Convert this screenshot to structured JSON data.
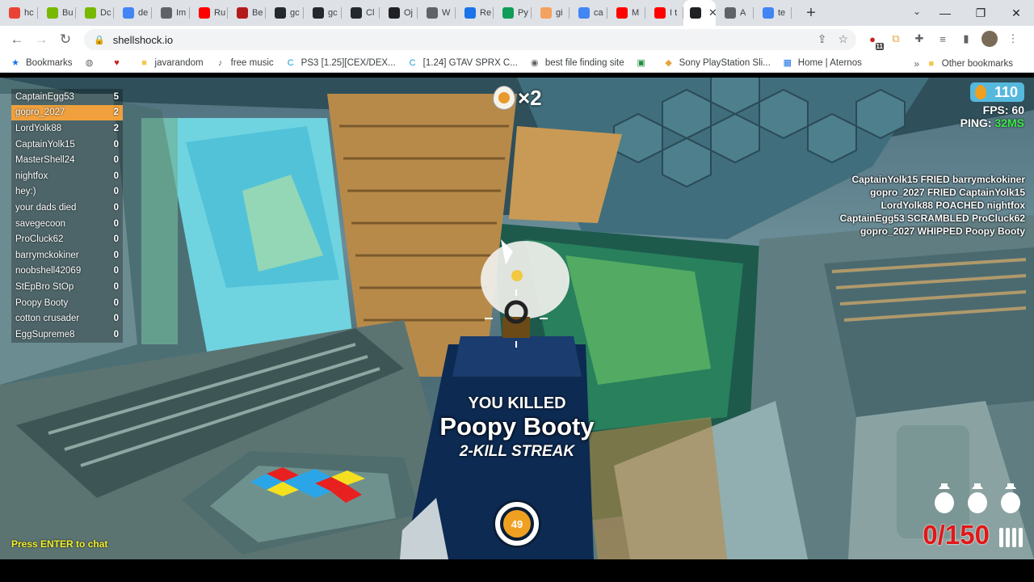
{
  "browser": {
    "tabs": [
      {
        "label": "hc",
        "icon": "puzzle-icon",
        "color": "#ea4335"
      },
      {
        "label": "Bu",
        "icon": "nvidia-icon",
        "color": "#76b900"
      },
      {
        "label": "Dc",
        "icon": "nvidia-icon",
        "color": "#76b900"
      },
      {
        "label": "de",
        "icon": "google-icon",
        "color": "#4285f4"
      },
      {
        "label": "Im",
        "icon": "chart-icon",
        "color": "#5f6368"
      },
      {
        "label": "Ru",
        "icon": "youtube-icon",
        "color": "#ff0000"
      },
      {
        "label": "Be",
        "icon": "m-icon",
        "color": "#b31b1b"
      },
      {
        "label": "gc",
        "icon": "github-icon",
        "color": "#24292e"
      },
      {
        "label": "gc",
        "icon": "github-icon",
        "color": "#24292e"
      },
      {
        "label": "Cl",
        "icon": "github-icon",
        "color": "#24292e"
      },
      {
        "label": "Oj",
        "icon": "openai-icon",
        "color": "#202124"
      },
      {
        "label": "W",
        "icon": "globe-icon",
        "color": "#5f6368"
      },
      {
        "label": "Re",
        "icon": "dot-icon",
        "color": "#1a73e8"
      },
      {
        "label": "Py",
        "icon": "w-icon",
        "color": "#0f9d58"
      },
      {
        "label": "gi",
        "icon": "swirl-icon",
        "color": "#f4a261"
      },
      {
        "label": "ca",
        "icon": "google-icon",
        "color": "#4285f4"
      },
      {
        "label": "M",
        "icon": "youtube-icon",
        "color": "#ff0000"
      },
      {
        "label": "I t",
        "icon": "youtube-icon",
        "color": "#ff0000"
      },
      {
        "label": "",
        "icon": "audio-icon",
        "color": "#202124",
        "active": true
      },
      {
        "label": "A",
        "icon": "image-icon",
        "color": "#5f6368"
      },
      {
        "label": "te",
        "icon": "google-icon",
        "color": "#4285f4"
      }
    ],
    "url": "shellshock.io",
    "bookmarks": [
      {
        "label": "Bookmarks",
        "icon": "star-icon"
      },
      {
        "label": "",
        "icon": "globe-icon"
      },
      {
        "label": "",
        "icon": "heart-icon"
      },
      {
        "label": "javarandom",
        "icon": "folder-icon"
      },
      {
        "label": "free music",
        "icon": "music-icon"
      },
      {
        "label": "PS3 [1.25][CEX/DEX...",
        "icon": "c-icon"
      },
      {
        "label": "[1.24] GTAV SPRX C...",
        "icon": "c-icon"
      },
      {
        "label": "best file finding site",
        "icon": "camera-icon"
      },
      {
        "label": "",
        "icon": "app-icon"
      },
      {
        "label": "Sony PlayStation Sli...",
        "icon": "bag-icon"
      },
      {
        "label": "Home | Aternos",
        "icon": "grid-icon"
      }
    ],
    "other_bookmarks": "Other bookmarks",
    "extension_badge": "11"
  },
  "game": {
    "leaderboard": [
      {
        "name": "CaptainEgg53",
        "score": "5"
      },
      {
        "name": "gopro_2027",
        "score": "2",
        "me": true
      },
      {
        "name": "LordYolk88",
        "score": "2"
      },
      {
        "name": "CaptainYolk15",
        "score": "0"
      },
      {
        "name": "MasterShell24",
        "score": "0"
      },
      {
        "name": "nightfox",
        "score": "0"
      },
      {
        "name": "hey:)",
        "score": "0"
      },
      {
        "name": "your dads died",
        "score": "0"
      },
      {
        "name": "savegecoon",
        "score": "0"
      },
      {
        "name": "ProCluck62",
        "score": "0"
      },
      {
        "name": "barrymckokiner",
        "score": "0"
      },
      {
        "name": "noobshell42069",
        "score": "0"
      },
      {
        "name": "StEpBro StOp",
        "score": "0"
      },
      {
        "name": "Poopy Booty",
        "score": "0"
      },
      {
        "name": "cotton crusader",
        "score": "0"
      },
      {
        "name": "EggSupreme8",
        "score": "0"
      }
    ],
    "killfeed": [
      "CaptainYolk15 FRIED barrymckokiner",
      "gopro_2027 FRIED CaptainYolk15",
      "LordYolk88 POACHED nightfox",
      "CaptainEgg53 SCRAMBLED ProCluck62",
      "gopro_2027 WHIPPED Poopy Booty"
    ],
    "eggs": "110",
    "fps_label": "FPS: ",
    "fps": "60",
    "ping_label": "PING: ",
    "ping": "32MS",
    "multiplier": "×2",
    "you_killed": "YOU KILLED",
    "victim": "Poopy Booty",
    "streak": "2-KILL STREAK",
    "timer": "49",
    "ammo": "0/150",
    "grenade_count": 3,
    "chat_prompt": "Press ENTER to chat"
  }
}
